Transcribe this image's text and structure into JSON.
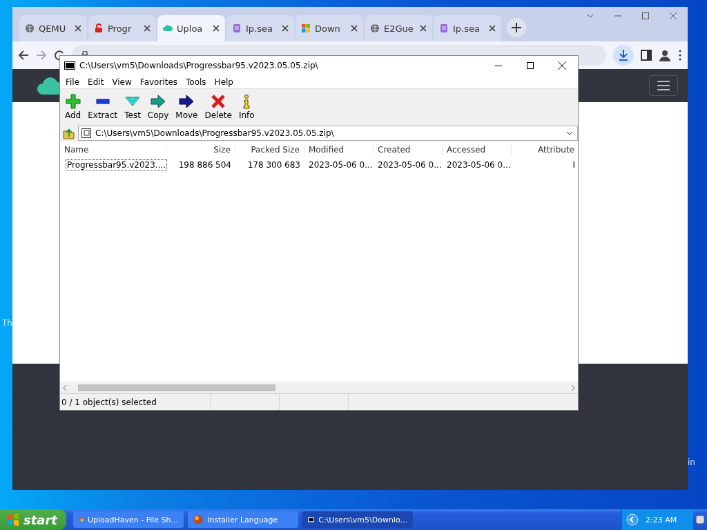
{
  "desktop": {
    "fragments": [
      "Th",
      "in"
    ]
  },
  "browser": {
    "tabs": [
      {
        "label": "QEMU",
        "selected": false,
        "kind": "globe"
      },
      {
        "label": "Progr",
        "selected": false,
        "kind": "lock"
      },
      {
        "label": "Uploa",
        "selected": true,
        "kind": "cloud"
      },
      {
        "label": "Ip.sea",
        "selected": false,
        "kind": "note"
      },
      {
        "label": "Down",
        "selected": false,
        "kind": "squares"
      },
      {
        "label": "E2Gue",
        "selected": false,
        "kind": "globe"
      },
      {
        "label": "Ip.sea",
        "selected": false,
        "kind": "note"
      }
    ]
  },
  "archive_window": {
    "title": "C:\\Users\\vm5\\Downloads\\Progressbar95.v2023.05.05.zip\\",
    "menu": [
      "File",
      "Edit",
      "View",
      "Favorites",
      "Tools",
      "Help"
    ],
    "toolbar": [
      {
        "label": "Add",
        "kind": "add"
      },
      {
        "label": "Extract",
        "kind": "extract"
      },
      {
        "label": "Test",
        "kind": "test"
      },
      {
        "label": "Copy",
        "kind": "copy"
      },
      {
        "label": "Move",
        "kind": "move"
      },
      {
        "label": "Delete",
        "kind": "delete"
      },
      {
        "label": "Info",
        "kind": "info"
      }
    ],
    "path": "C:\\Users\\vm5\\Downloads\\Progressbar95.v2023.05.05.zip\\",
    "columns": [
      "Name",
      "Size",
      "Packed Size",
      "Modified",
      "Created",
      "Accessed",
      "Attribute"
    ],
    "rows": [
      {
        "cells": [
          "Progressbar95.v2023....",
          "198 886 504",
          "178 300 683",
          "2023-05-06 0...",
          "2023-05-06 0...",
          "2023-05-06 0...",
          "I"
        ],
        "selected": false
      }
    ],
    "status": "0 / 1 object(s) selected"
  },
  "taskbar": {
    "start": "start",
    "tasks": [
      {
        "label": "UploadHaven - File Sh...",
        "selected": false,
        "kind": "chrome"
      },
      {
        "label": "Installer Language",
        "selected": false,
        "kind": "installer"
      },
      {
        "label": "C:\\Users\\vm5\\Downlo...",
        "selected": true,
        "kind": "archive"
      }
    ],
    "clock": "2:23 AM"
  }
}
